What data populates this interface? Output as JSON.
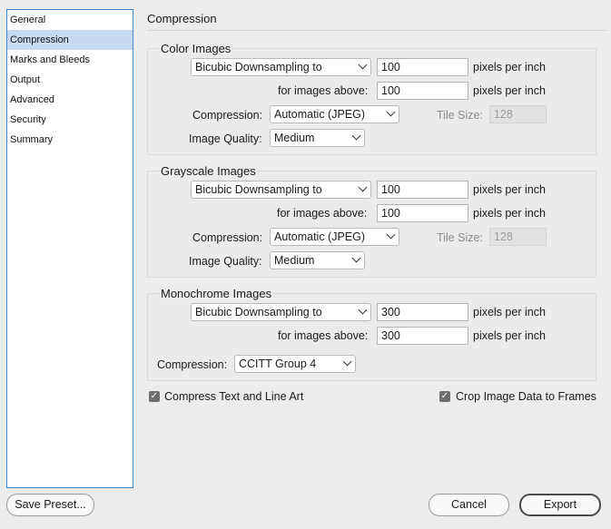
{
  "sidebar": {
    "items": [
      {
        "label": "General",
        "selected": false
      },
      {
        "label": "Compression",
        "selected": true
      },
      {
        "label": "Marks and Bleeds",
        "selected": false
      },
      {
        "label": "Output",
        "selected": false
      },
      {
        "label": "Advanced",
        "selected": false
      },
      {
        "label": "Security",
        "selected": false
      },
      {
        "label": "Summary",
        "selected": false
      }
    ]
  },
  "main": {
    "title": "Compression",
    "color": {
      "title": "Color Images",
      "downsampling": "Bicubic Downsampling to",
      "ppi": "100",
      "ppi_unit": "pixels per inch",
      "above_label": "for images above:",
      "above_value": "100",
      "above_unit": "pixels per inch",
      "compression_label": "Compression:",
      "compression": "Automatic (JPEG)",
      "tile_label": "Tile Size:",
      "tile_value": "128",
      "quality_label": "Image Quality:",
      "quality": "Medium"
    },
    "grayscale": {
      "title": "Grayscale Images",
      "downsampling": "Bicubic Downsampling to",
      "ppi": "100",
      "ppi_unit": "pixels per inch",
      "above_label": "for images above:",
      "above_value": "100",
      "above_unit": "pixels per inch",
      "compression_label": "Compression:",
      "compression": "Automatic (JPEG)",
      "tile_label": "Tile Size:",
      "tile_value": "128",
      "quality_label": "Image Quality:",
      "quality": "Medium"
    },
    "monochrome": {
      "title": "Monochrome Images",
      "downsampling": "Bicubic Downsampling to",
      "ppi": "300",
      "ppi_unit": "pixels per inch",
      "above_label": "for images above:",
      "above_value": "300",
      "above_unit": "pixels per inch",
      "compression_label": "Compression:",
      "compression": "CCITT Group 4"
    },
    "compress_text": {
      "label": "Compress Text and Line Art",
      "checked": true
    },
    "crop_image": {
      "label": "Crop Image Data to Frames",
      "checked": true
    }
  },
  "footer": {
    "save_preset": "Save Preset...",
    "cancel": "Cancel",
    "export": "Export"
  }
}
